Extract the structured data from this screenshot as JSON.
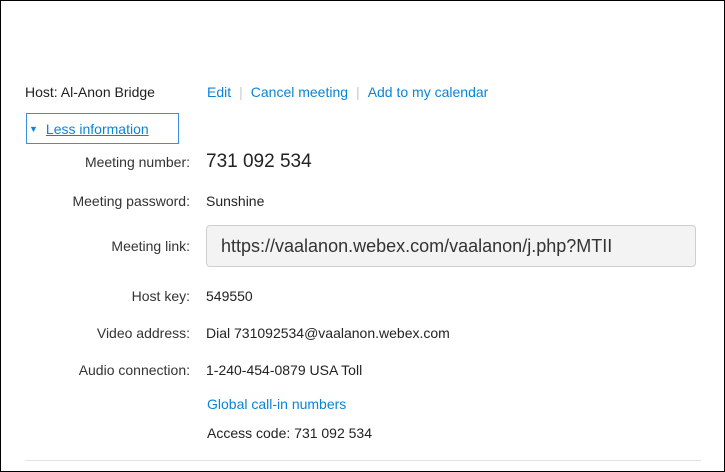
{
  "host": {
    "label": "Host: Al-Anon Bridge",
    "edit_label": "Edit",
    "cancel_label": "Cancel meeting",
    "calendar_label": "Add to my calendar"
  },
  "toggle": {
    "label": "Less information",
    "icon": "caret-down-icon"
  },
  "details": {
    "meeting_number": {
      "label": "Meeting number:",
      "value": "731 092 534"
    },
    "meeting_password": {
      "label": "Meeting password:",
      "value": "Sunshine"
    },
    "meeting_link": {
      "label": "Meeting link:",
      "value": "https://vaalanon.webex.com/vaalanon/j.php?MTII"
    },
    "host_key": {
      "label": "Host key:",
      "value": "549550"
    },
    "video_address": {
      "label": "Video address:",
      "value": "Dial 731092534@vaalanon.webex.com"
    },
    "audio_connection": {
      "label": "Audio connection:",
      "value": "1-240-454-0879 USA Toll",
      "global_link": "Global call-in numbers",
      "access_code": "Access code: 731 092 534"
    }
  },
  "colors": {
    "link": "#0a84d6",
    "toggle_border": "#3b8fdc"
  }
}
